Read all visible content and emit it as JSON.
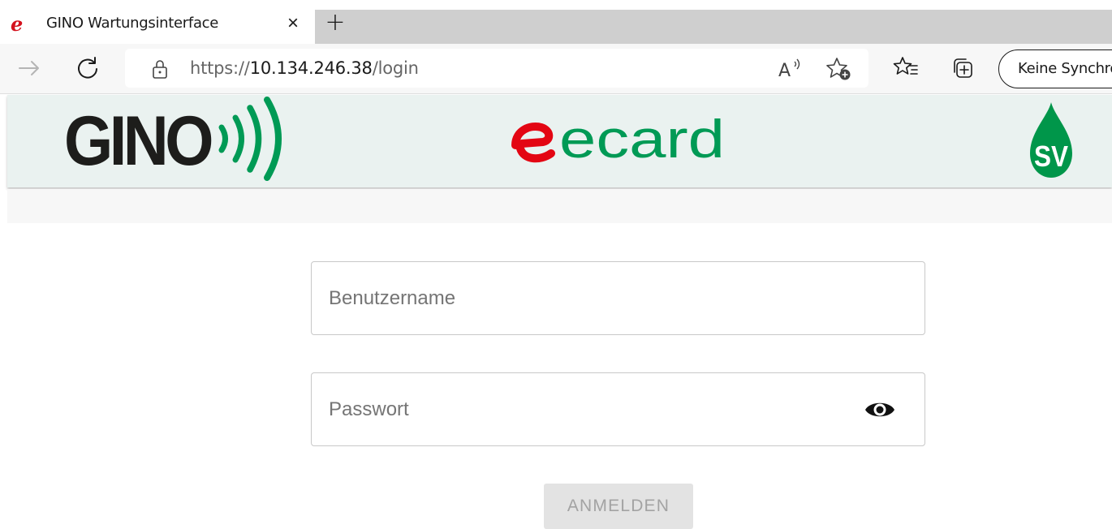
{
  "browser": {
    "tab": {
      "title": "GINO Wartungsinterface",
      "close_glyph": "×",
      "favicon": "edge-e-icon"
    },
    "new_tab_glyph": "+",
    "address": {
      "scheme": "https://",
      "host": "10.134.246.38",
      "path": "/login"
    },
    "sync_button_label": "Keine Synchronisierung"
  },
  "header": {
    "gino_logo_text": "GINO",
    "ecard_logo_text": "ecard",
    "sv_logo_text": "SV",
    "colors": {
      "gino_dark": "#1d1d1b",
      "gino_green": "#009a55",
      "ecard_red": "#e30613",
      "ecard_green": "#009a55",
      "sv_green": "#00964a",
      "header_bg": "#eaf2f0"
    }
  },
  "form": {
    "username_placeholder": "Benutzername",
    "password_placeholder": "Passwort",
    "submit_label": "ANMELDEN"
  }
}
